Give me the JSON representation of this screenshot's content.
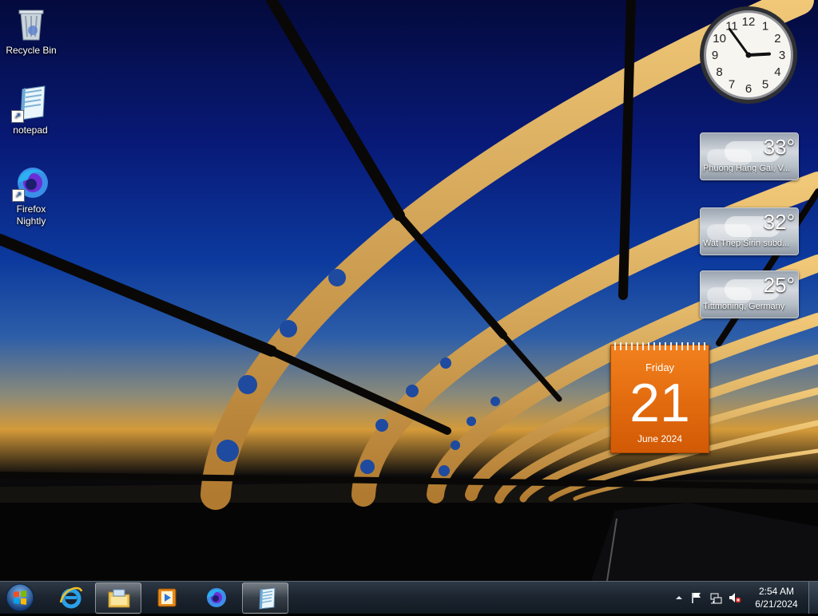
{
  "desktop": {
    "icons": [
      {
        "label": "Recycle Bin",
        "icon": "recycle-bin-icon"
      },
      {
        "label": "notepad",
        "icon": "notepad-icon"
      },
      {
        "label": "Firefox Nightly",
        "icon": "firefox-nightly-icon"
      }
    ]
  },
  "gadgets": {
    "clock": {
      "numerals": [
        "12",
        "1",
        "2",
        "3",
        "4",
        "5",
        "6",
        "7",
        "8",
        "9",
        "10",
        "11"
      ],
      "hour": 2,
      "minute": 54
    },
    "weather": [
      {
        "temp": "33°",
        "place": "Phuong Hàng Gai, V..."
      },
      {
        "temp": "32°",
        "place": "Wat Thep Sirin subd..."
      },
      {
        "temp": "25°",
        "place": "Tittmoning, Germany"
      }
    ],
    "calendar": {
      "weekday": "Friday",
      "day": "21",
      "month_year": "June 2024"
    }
  },
  "taskbar": {
    "start_icon": "windows-start-icon",
    "pinned": [
      {
        "name": "internet-explorer",
        "icon": "internet-explorer-icon",
        "active": false
      },
      {
        "name": "windows-explorer",
        "icon": "folder-icon",
        "active": true
      },
      {
        "name": "media-player",
        "icon": "media-player-icon",
        "active": false
      },
      {
        "name": "firefox-nightly",
        "icon": "firefox-nightly-icon",
        "active": false
      },
      {
        "name": "notepad",
        "icon": "notepad-icon",
        "active": true
      }
    ],
    "tray": {
      "icons": [
        "show-hidden-icons-icon",
        "action-center-flag-icon",
        "network-icon",
        "volume-muted-icon"
      ],
      "time": "2:54 AM",
      "date": "6/21/2024"
    }
  },
  "colors": {
    "calendar_orange": "#e26a0e",
    "sky_dark": "#040a3c",
    "sky_mid": "#0c3a9e",
    "bridge_gold": "#e8b866"
  }
}
